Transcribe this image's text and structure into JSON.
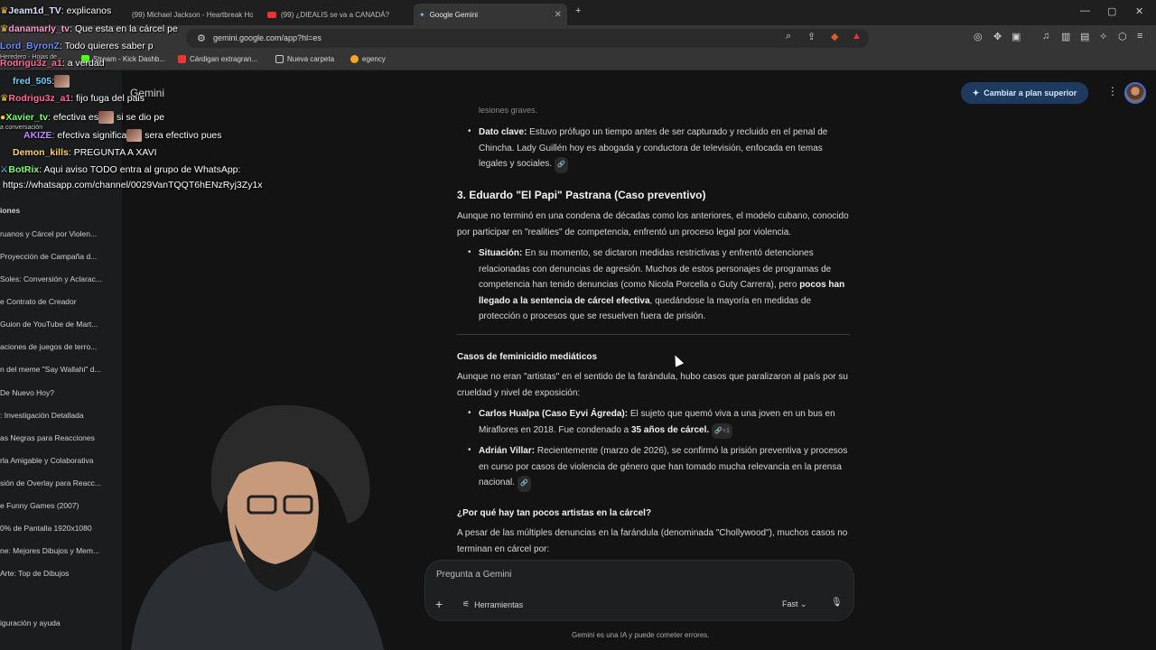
{
  "browser": {
    "tabs": [
      {
        "label": "(99) Michael Jackson - Heartbreak Ho"
      },
      {
        "label": "(99) ¿DIEALIS se va a CANADÁ?"
      },
      {
        "label": "Google Gemini",
        "active": true
      }
    ],
    "url": "gemini.google.com/app?hl=es",
    "bookmarks": [
      {
        "label": "Cárdigan extragran..."
      },
      {
        "label": "Nueva carpeta"
      },
      {
        "label": "egency"
      }
    ],
    "bookmark_partial": "Stream - Kick Dashb..."
  },
  "app": {
    "name": "Gemini",
    "upgrade_label": "Cambiar a plan superior",
    "sidebar": {
      "section_label": "iones",
      "items": [
        "ruanos y Cárcel por Violen...",
        "Proyección de Campaña d...",
        "Soles: Conversión y Aclarac...",
        "e Contrato de Creador",
        "Guion de YouTube de Mart...",
        "aciones de juegos de terro...",
        "n del meme \"Say Wallahi\" d...",
        "De Nuevo Hoy?",
        ": Investigación Detallada",
        "as Negras para Reacciones",
        "rla Amigable y Colaborativa",
        "sión de Overlay para Reacc...",
        "e Funny Games (2007)",
        "0% de Pantalla 1920x1080",
        "ne: Mejores Dibujos y Mem...",
        "Arte: Top de Dibujos"
      ],
      "footer": "iguración y ayuda"
    },
    "response": {
      "top_partial": "lesiones graves.",
      "dato_clave_label": "Dato clave:",
      "dato_clave_text": " Estuvo prófugo un tiempo antes de ser capturado y recluido en el penal de Chincha. Lady Guillén hoy es abogada y conductora de televisión, enfocada en temas legales y sociales.",
      "heading3": "3. Eduardo \"El Papi\" Pastrana (Caso preventivo)",
      "para1": "Aunque no terminó en una condena de décadas como los anteriores, el modelo cubano, conocido por participar en \"realities\" de competencia, enfrentó un proceso legal por violencia.",
      "situacion_label": "Situación:",
      "situacion_text_a": " En su momento, se dictaron medidas restrictivas y enfrentó detenciones relacionadas con denuncias de agresión. Muchos de estos personajes de programas de competencia han tenido denuncias (como Nicola Porcella o Guty Carrera), pero ",
      "situacion_bold": "pocos han llegado a la sentencia de cárcel efectiva",
      "situacion_text_b": ", quedándose la mayoría en medidas de protección o procesos que se resuelven fuera de prisión.",
      "heading4a": "Casos de feminicidio mediáticos",
      "para2": "Aunque no eran \"artistas\" en el sentido de la farándula, hubo casos que paralizaron al país por su crueldad y nivel de exposición:",
      "carlos_label": "Carlos Hualpa (Caso Eyvi Ágreda):",
      "carlos_text": " El sujeto que quemó viva a una joven en un bus en Miraflores en 2018. Fue condenado a ",
      "carlos_bold": "35 años de cárcel.",
      "carlos_chip": "+1",
      "adrian_label": "Adrián Villar:",
      "adrian_text": " Recientemente (marzo de 2026), se confirmó la prisión preventiva y procesos en curso por casos de violencia de género que han tomado mucha relevancia en la prensa nacional.",
      "heading4b": "¿Por qué hay tan pocos artistas en la cárcel?",
      "para3": "A pesar de las múltiples denuncias en la farándula (denominada \"Chollywood\"), muchos casos no terminan en cárcel por:"
    },
    "composer": {
      "placeholder": "Pregunta a Gemini",
      "tools_label": "Herramientas",
      "mode_label": "Fast",
      "disclaimer": "Gemini es una IA y puede cometer errores."
    }
  },
  "stream_chat": [
    {
      "user": "Jeam1d_TV",
      "msg": ": explicanos",
      "color": "#e0e0ff"
    },
    {
      "user": "danamarly_tv",
      "msg": ": Que esta en la cárcel pe",
      "color": "#ff9ad5"
    },
    {
      "user": "Lord_ByronZ",
      "msg": ": Todo quieres saber p",
      "color": "#6b8cff"
    },
    {
      "user": "Rodrigu3z_a1",
      "msg": ": a verdad",
      "color": "#ff6b9a"
    },
    {
      "user": "fred_505",
      "msg": ":",
      "color": "#6bd0ff"
    },
    {
      "user": "Rodrigu3z_a1",
      "msg": ": fijo fuga del pais",
      "color": "#ff6b9a"
    },
    {
      "user": "Xavier_tv",
      "msg": ": efectiva es",
      "msg2": " si se dio pe",
      "color": "#7cff6b"
    },
    {
      "user": "AKIZE",
      "msg": ": efectiva significa",
      "msg2": " sera efectivo pues",
      "color": "#c28bff"
    },
    {
      "user": "Demon_kills",
      "msg": ": PREGUNTA A XAVI",
      "color": "#ffd36b"
    },
    {
      "user": "BotRix",
      "msg": ": Aqui aviso TODO entra al grupo de WhatsApp:",
      "color": "#7cff6b"
    },
    {
      "user": "",
      "msg": "https://whatsapp.com/channel/0029VanTQQT6hENzRyj3Zy1x",
      "color": "#ffffff"
    }
  ],
  "overlay_partial": {
    "conversation": "a conversación",
    "tab_fragment": "Heredero - Hojas de..."
  },
  "colors": {
    "accent": "#1e3a5f",
    "background": "#131314",
    "sidebar": "#1b1c1d"
  }
}
